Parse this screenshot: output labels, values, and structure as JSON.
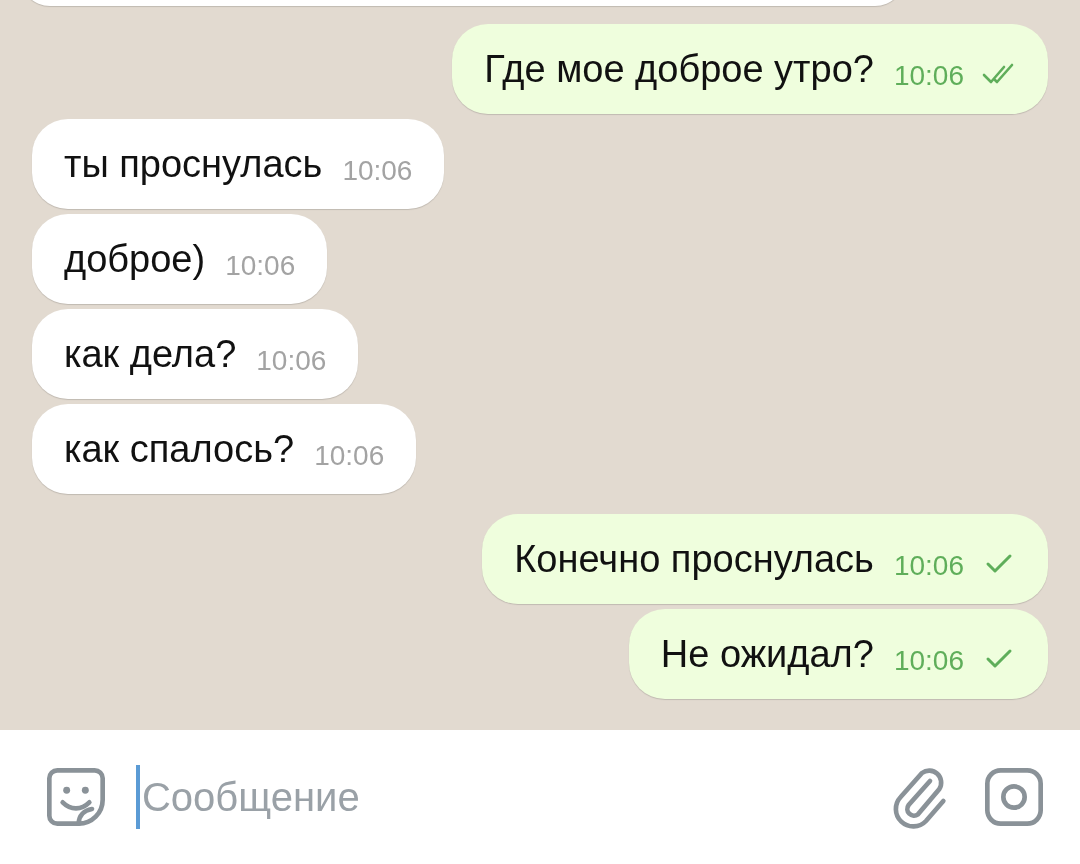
{
  "messages": [
    {
      "kind": "incoming_cut"
    },
    {
      "kind": "outgoing",
      "text": "Где мое доброе утро?",
      "time": "10:06",
      "read": true
    },
    {
      "kind": "incoming",
      "text": "ты проснулась",
      "time": "10:06"
    },
    {
      "kind": "incoming",
      "text": "доброе)",
      "time": "10:06"
    },
    {
      "kind": "incoming",
      "text": "как дела?",
      "time": "10:06"
    },
    {
      "kind": "incoming",
      "text": "как спалось?",
      "time": "10:06"
    },
    {
      "kind": "outgoing",
      "text": "Конечно проснулась",
      "time": "10:06",
      "read": false
    },
    {
      "kind": "outgoing",
      "text": "Не ожидал?",
      "time": "10:06",
      "read": false
    }
  ],
  "composer": {
    "placeholder": "Сообщение"
  }
}
